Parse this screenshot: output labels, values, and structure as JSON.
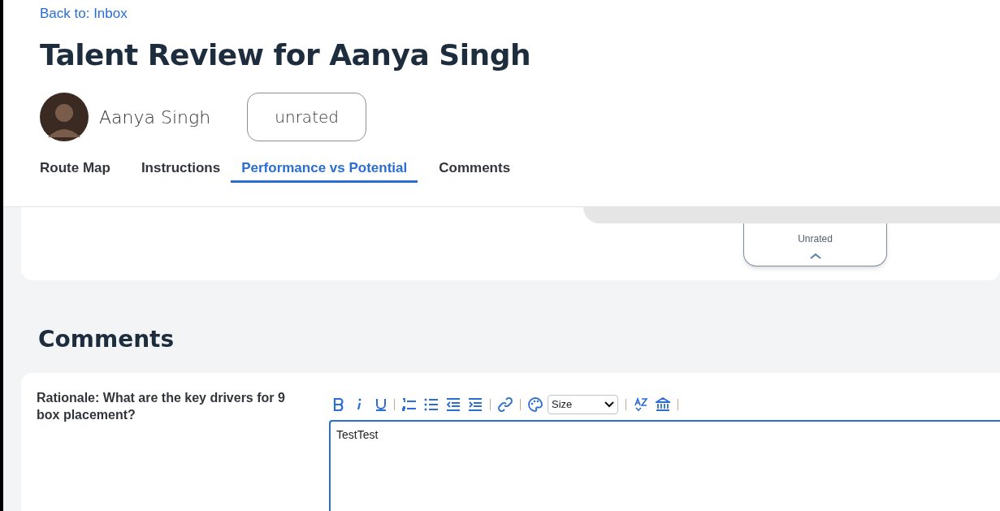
{
  "back_link": "Back to: Inbox",
  "title": "Talent Review for Aanya Singh",
  "employee": {
    "name": "Aanya Singh",
    "rating_badge": "unrated"
  },
  "tabs": [
    {
      "label": "Route Map",
      "selected": false
    },
    {
      "label": "Instructions",
      "selected": false
    },
    {
      "label": "Performance vs Potential",
      "selected": true
    },
    {
      "label": "Comments",
      "selected": false
    }
  ],
  "rating_card": {
    "label": "Unrated"
  },
  "comments_section": {
    "heading": "Comments",
    "question": "Rationale: What are the key drivers for 9 box placement?",
    "size_select": "Size",
    "value": "TestTest"
  }
}
